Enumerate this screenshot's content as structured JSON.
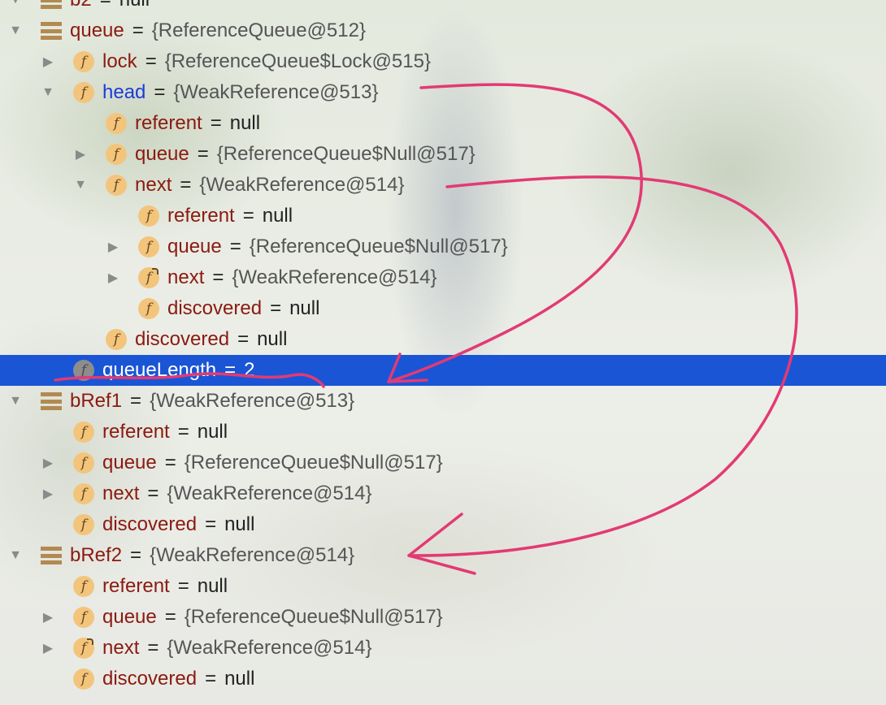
{
  "tree": {
    "rows": [
      {
        "depth": 0,
        "expander": "expanded",
        "icon": "var",
        "name": "b2",
        "value": "null",
        "partial": true
      },
      {
        "depth": 0,
        "expander": "expanded",
        "icon": "var",
        "name": "queue",
        "value": "{ReferenceQueue@512}"
      },
      {
        "depth": 1,
        "expander": "collapsed",
        "icon": "field",
        "name": "lock",
        "value": "{ReferenceQueue$Lock@515}"
      },
      {
        "depth": 1,
        "expander": "expanded",
        "icon": "field",
        "name": "head",
        "value": "{WeakReference@513}",
        "highlight": "blue-name"
      },
      {
        "depth": 2,
        "expander": "none",
        "icon": "field",
        "name": "referent",
        "value": "null"
      },
      {
        "depth": 2,
        "expander": "collapsed",
        "icon": "field",
        "name": "queue",
        "value": "{ReferenceQueue$Null@517}"
      },
      {
        "depth": 2,
        "expander": "expanded",
        "icon": "field",
        "name": "next",
        "value": "{WeakReference@514}"
      },
      {
        "depth": 3,
        "expander": "none",
        "icon": "field",
        "name": "referent",
        "value": "null"
      },
      {
        "depth": 3,
        "expander": "collapsed",
        "icon": "field",
        "name": "queue",
        "value": "{ReferenceQueue$Null@517}"
      },
      {
        "depth": 3,
        "expander": "collapsed",
        "icon": "field-final",
        "name": "next",
        "value": "{WeakReference@514}"
      },
      {
        "depth": 3,
        "expander": "none",
        "icon": "field",
        "name": "discovered",
        "value": "null"
      },
      {
        "depth": 2,
        "expander": "none",
        "icon": "field",
        "name": "discovered",
        "value": "null"
      },
      {
        "depth": 1,
        "expander": "none",
        "icon": "field-gray",
        "name": "queueLength",
        "value": "2",
        "selected": true
      },
      {
        "depth": 0,
        "expander": "expanded",
        "icon": "var",
        "name": "bRef1",
        "value": "{WeakReference@513}"
      },
      {
        "depth": 1,
        "expander": "none",
        "icon": "field",
        "name": "referent",
        "value": "null"
      },
      {
        "depth": 1,
        "expander": "collapsed",
        "icon": "field",
        "name": "queue",
        "value": "{ReferenceQueue$Null@517}"
      },
      {
        "depth": 1,
        "expander": "collapsed",
        "icon": "field",
        "name": "next",
        "value": "{WeakReference@514}"
      },
      {
        "depth": 1,
        "expander": "none",
        "icon": "field",
        "name": "discovered",
        "value": "null"
      },
      {
        "depth": 0,
        "expander": "expanded",
        "icon": "var",
        "name": "bRef2",
        "value": "{WeakReference@514}"
      },
      {
        "depth": 1,
        "expander": "none",
        "icon": "field",
        "name": "referent",
        "value": "null"
      },
      {
        "depth": 1,
        "expander": "collapsed",
        "icon": "field",
        "name": "queue",
        "value": "{ReferenceQueue$Null@517}"
      },
      {
        "depth": 1,
        "expander": "collapsed",
        "icon": "field-final",
        "name": "next",
        "value": "{WeakReference@514}"
      },
      {
        "depth": 1,
        "expander": "none",
        "icon": "field",
        "name": "discovered",
        "value": "null"
      }
    ],
    "equals": "=",
    "field_icon_glyph": "f",
    "colors": {
      "selection": "#1a55d6",
      "field_name": "#8b1a10",
      "head_name": "#1b3cd8",
      "icon_fill": "#f3c57c",
      "annotation": "#e23a74"
    }
  },
  "annotations": {
    "description_free": true,
    "arrows": [
      {
        "from_row": "head",
        "to_row": "queueLength"
      },
      {
        "from_row": "next",
        "to_row": "bRef2"
      }
    ],
    "underline_row": "queueLength"
  }
}
